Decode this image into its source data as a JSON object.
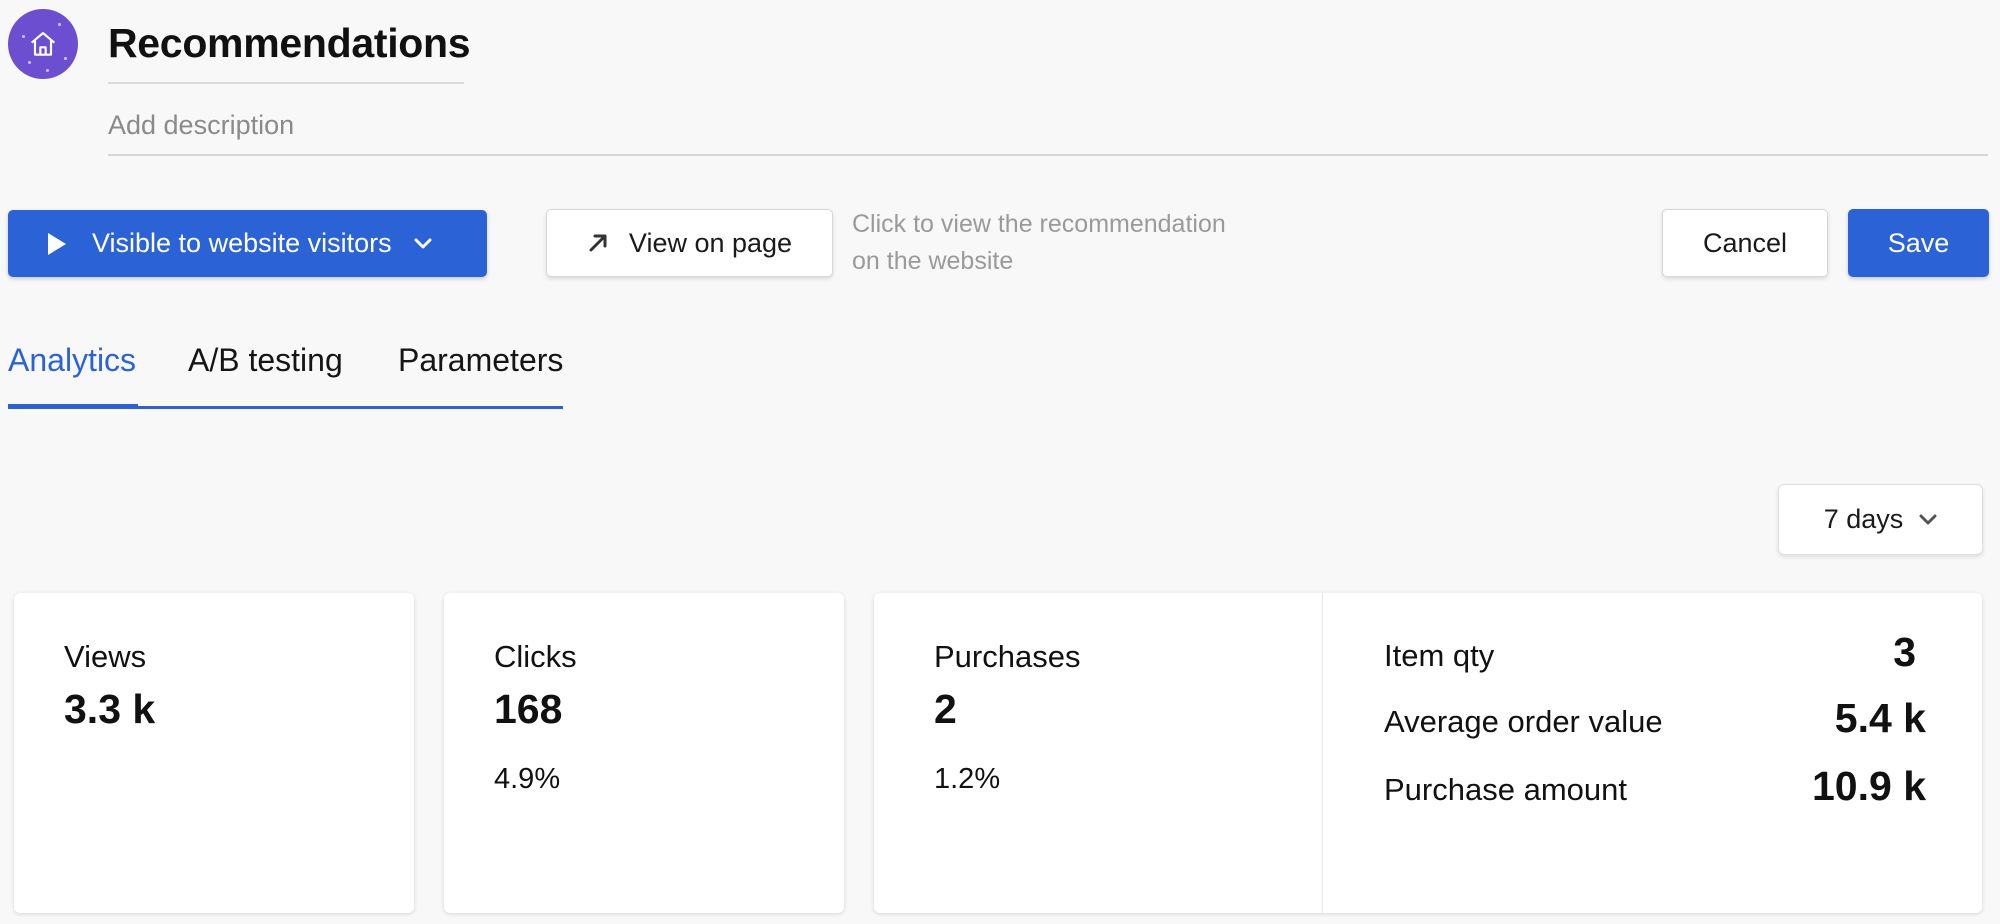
{
  "header": {
    "title": "Recommendations",
    "description_placeholder": "Add description"
  },
  "toolbar": {
    "visibility_label": "Visible to website visitors",
    "view_on_page_label": "View on page",
    "hint_line1": "Click to view the recommendation",
    "hint_line2": "on the website",
    "cancel_label": "Cancel",
    "save_label": "Save"
  },
  "tabs": [
    {
      "label": "Analytics",
      "active": true
    },
    {
      "label": "A/B testing",
      "active": false
    },
    {
      "label": "Parameters",
      "active": false
    }
  ],
  "period": {
    "selected": "7 days"
  },
  "metrics": {
    "views": {
      "label": "Views",
      "value": "3.3 k"
    },
    "clicks": {
      "label": "Clicks",
      "value": "168",
      "rate": "4.9%"
    },
    "purchases": {
      "label": "Purchases",
      "value": "2",
      "rate": "1.2%"
    },
    "details": [
      {
        "label": "Item qty",
        "value": "3"
      },
      {
        "label": "Average order value",
        "value": "5.4 k"
      },
      {
        "label": "Purchase amount",
        "value": "10.9 k"
      }
    ]
  },
  "colors": {
    "accent": "#2b63d6",
    "avatar": "#6b4fd0",
    "muted_text": "#9a9a9a"
  },
  "icons": {
    "avatar": "home-icon",
    "visibility": "play-icon",
    "visibility_dropdown": "chevron-down-icon",
    "view_on_page": "arrow-up-right-icon",
    "period_dropdown": "chevron-down-icon"
  }
}
